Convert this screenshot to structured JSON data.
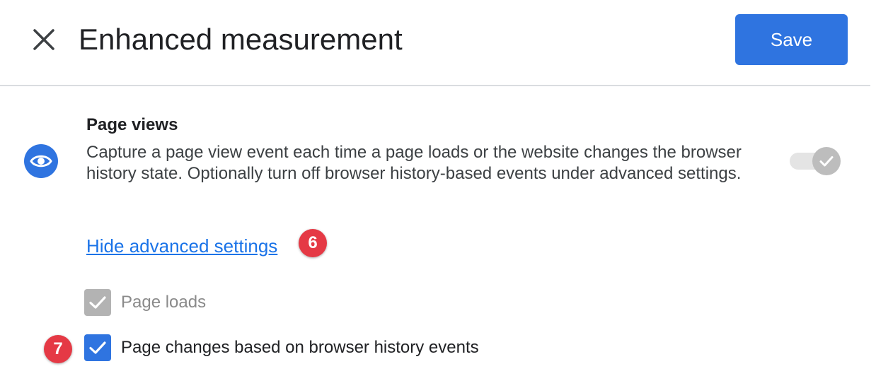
{
  "header": {
    "title": "Enhanced measurement",
    "close_icon": "close-icon",
    "save_label": "Save"
  },
  "section": {
    "icon": "eye-icon",
    "title": "Page views",
    "description": "Capture a page view event each time a page loads or the website changes the browser history state. Optionally turn off browser history-based events under advanced settings.",
    "toggle_on": true,
    "toggle_disabled": true
  },
  "advanced": {
    "link_label": "Hide advanced settings",
    "options": [
      {
        "label": "Page loads",
        "checked": true,
        "disabled": true
      },
      {
        "label": "Page changes based on browser history events",
        "checked": true,
        "disabled": false
      }
    ]
  },
  "annotations": [
    {
      "number": "6"
    },
    {
      "number": "7"
    }
  ],
  "colors": {
    "accent": "#2f74e0",
    "link": "#1a73e8",
    "badge": "#e53945",
    "disabled": "#b3b3b3"
  }
}
